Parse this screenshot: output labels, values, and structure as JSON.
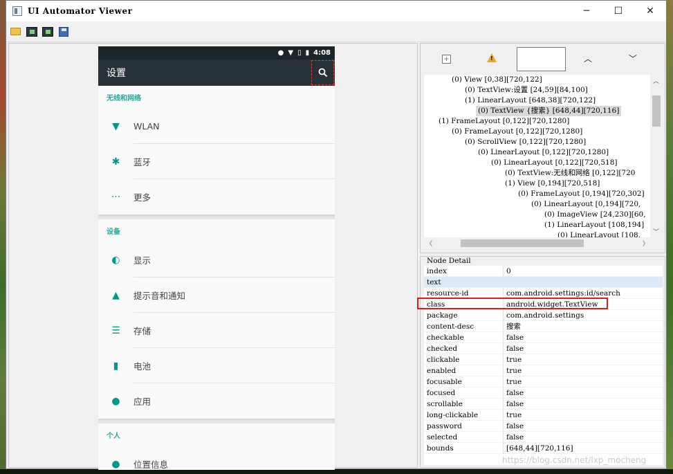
{
  "window": {
    "title": "UI Automator Viewer"
  },
  "win_controls": {
    "minimize": "─",
    "maximize": "☐",
    "close": "✕"
  },
  "phone": {
    "status_time": "4:08",
    "appbar_title": "设置",
    "sections": [
      {
        "header": "无线和网络",
        "items": [
          "WLAN",
          "蓝牙",
          "更多"
        ]
      },
      {
        "header": "设备",
        "items": [
          "显示",
          "提示音和通知",
          "存储",
          "电池",
          "应用"
        ]
      },
      {
        "header": "个人",
        "items": [
          "位置信息"
        ]
      }
    ]
  },
  "tree_nav": {
    "up": "︿",
    "down": "﹀"
  },
  "tree": [
    "(0) View [0,38][720,122]",
    "(0) TextView:设置 [24,59][84,100]",
    "(1) LinearLayout [648,38][720,122]",
    "(0) TextView {搜索} [648,44][720,116]",
    "(1) FrameLayout [0,122][720,1280]",
    "(0) FrameLayout [0,122][720,1280]",
    "(0) ScrollView [0,122][720,1280]",
    "(0) LinearLayout [0,122][720,1280]",
    "(0) LinearLayout [0,122][720,518]",
    "(0) TextView:无线和网络 [0,122][720",
    "(1) View [0,194][720,518]",
    "(0) FrameLayout [0,194][720,302]",
    "(0) LinearLayout [0,194][720,",
    "(0) ImageView [24,230][60,",
    "(1) LinearLayout [108,194]",
    "(0) LinearLayout [108,"
  ],
  "detail": {
    "title": "Node Detail",
    "rows": [
      [
        "index",
        "0"
      ],
      [
        "text",
        ""
      ],
      [
        "resource-id",
        "com.android.settings:id/search"
      ],
      [
        "class",
        "android.widget.TextView"
      ],
      [
        "package",
        "com.android.settings"
      ],
      [
        "content-desc",
        "搜索"
      ],
      [
        "checkable",
        "false"
      ],
      [
        "checked",
        "false"
      ],
      [
        "clickable",
        "true"
      ],
      [
        "enabled",
        "true"
      ],
      [
        "focusable",
        "true"
      ],
      [
        "focused",
        "false"
      ],
      [
        "scrollable",
        "false"
      ],
      [
        "long-clickable",
        "true"
      ],
      [
        "password",
        "false"
      ],
      [
        "selected",
        "false"
      ],
      [
        "bounds",
        "[648,44][720,116]"
      ]
    ]
  },
  "watermark": "https://blog.csdn.net/lxp_mocheng",
  "colors": {
    "accent": "#009688",
    "appbar": "#263238",
    "statusbar": "#1c2529",
    "highlight_box": "#e21a1a"
  }
}
